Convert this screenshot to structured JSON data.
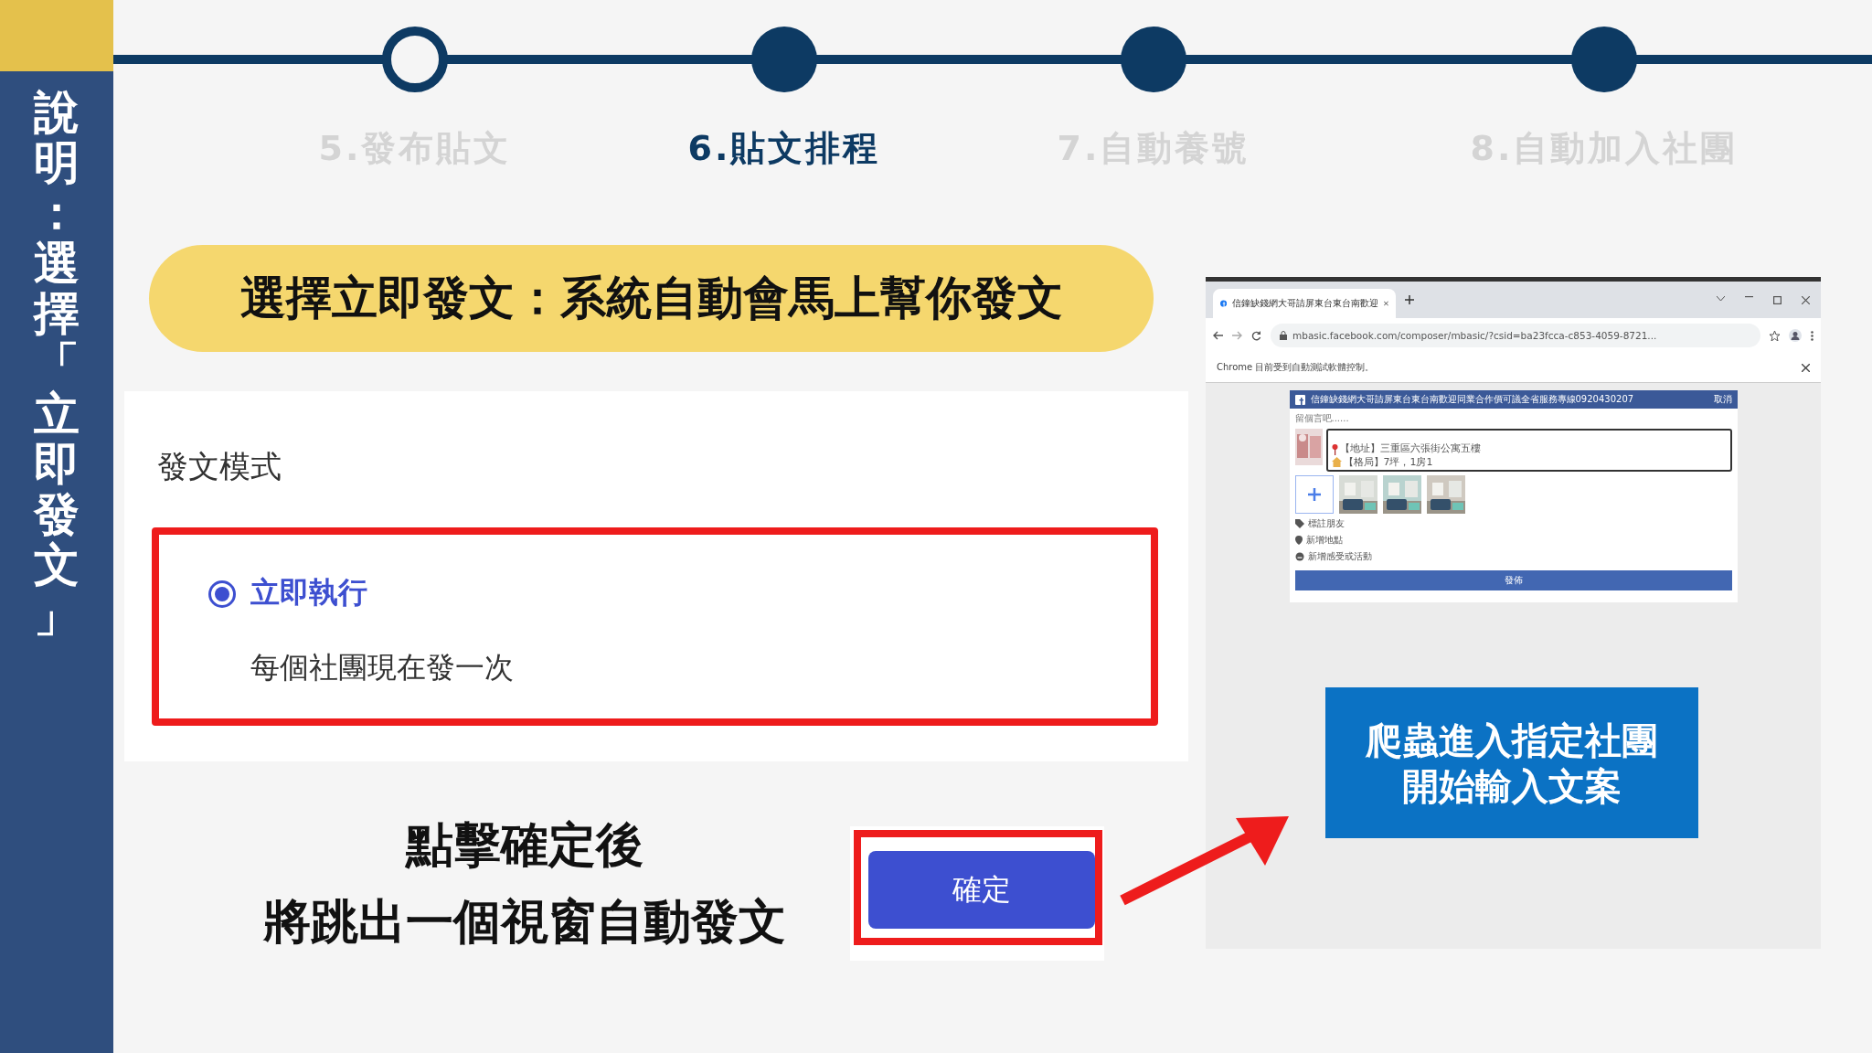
{
  "sidebar": {
    "title": "說明：選擇「立即發文」"
  },
  "steps": [
    {
      "label": "5.發布貼文",
      "selected": false,
      "kind": "ring"
    },
    {
      "label": "6.貼文排程",
      "selected": true,
      "kind": "dot"
    },
    {
      "label": "7.自動養號",
      "selected": false,
      "kind": "dot"
    },
    {
      "label": "8.自動加入社團",
      "selected": false,
      "kind": "dot"
    }
  ],
  "banner": "選擇立即發文：系統自動會馬上幫你發文",
  "form": {
    "title": "發文模式",
    "option": {
      "label": "立即執行",
      "selected": true,
      "description": "每個社團現在發一次"
    }
  },
  "caption": [
    "點擊確定後",
    "將跳出一個視窗自動發文"
  ],
  "confirm_button": "確定",
  "browser": {
    "tab_title": "信鐘缺錢網大哥請屏東台東台南歡迎",
    "url": "mbasic.facebook.com/composer/mbasic/?csid=ba23fcca-c853-4059-8721...",
    "infobar": "Chrome 目前受到自動測試軟體控制。",
    "composer": {
      "group": "信鐘缺錢網大哥請屏東台東台南歡迎同業合作價可議全省服務專線0920430207",
      "cancel": "取消",
      "prompt": "留個言吧......",
      "text_lines": [
        {
          "kind": "pin",
          "text": "【地址】三重區六張街公寓五樓"
        },
        {
          "kind": "house",
          "text": "【格局】7坪，1房1"
        }
      ],
      "actions": [
        {
          "kind": "tag",
          "label": "標註朋友"
        },
        {
          "kind": "place",
          "label": "新增地點"
        },
        {
          "kind": "feeling",
          "label": "新增感受或活動"
        }
      ],
      "post_button": "發佈"
    }
  },
  "note": [
    "爬蟲進入指定社團",
    "開始輸入文案"
  ]
}
